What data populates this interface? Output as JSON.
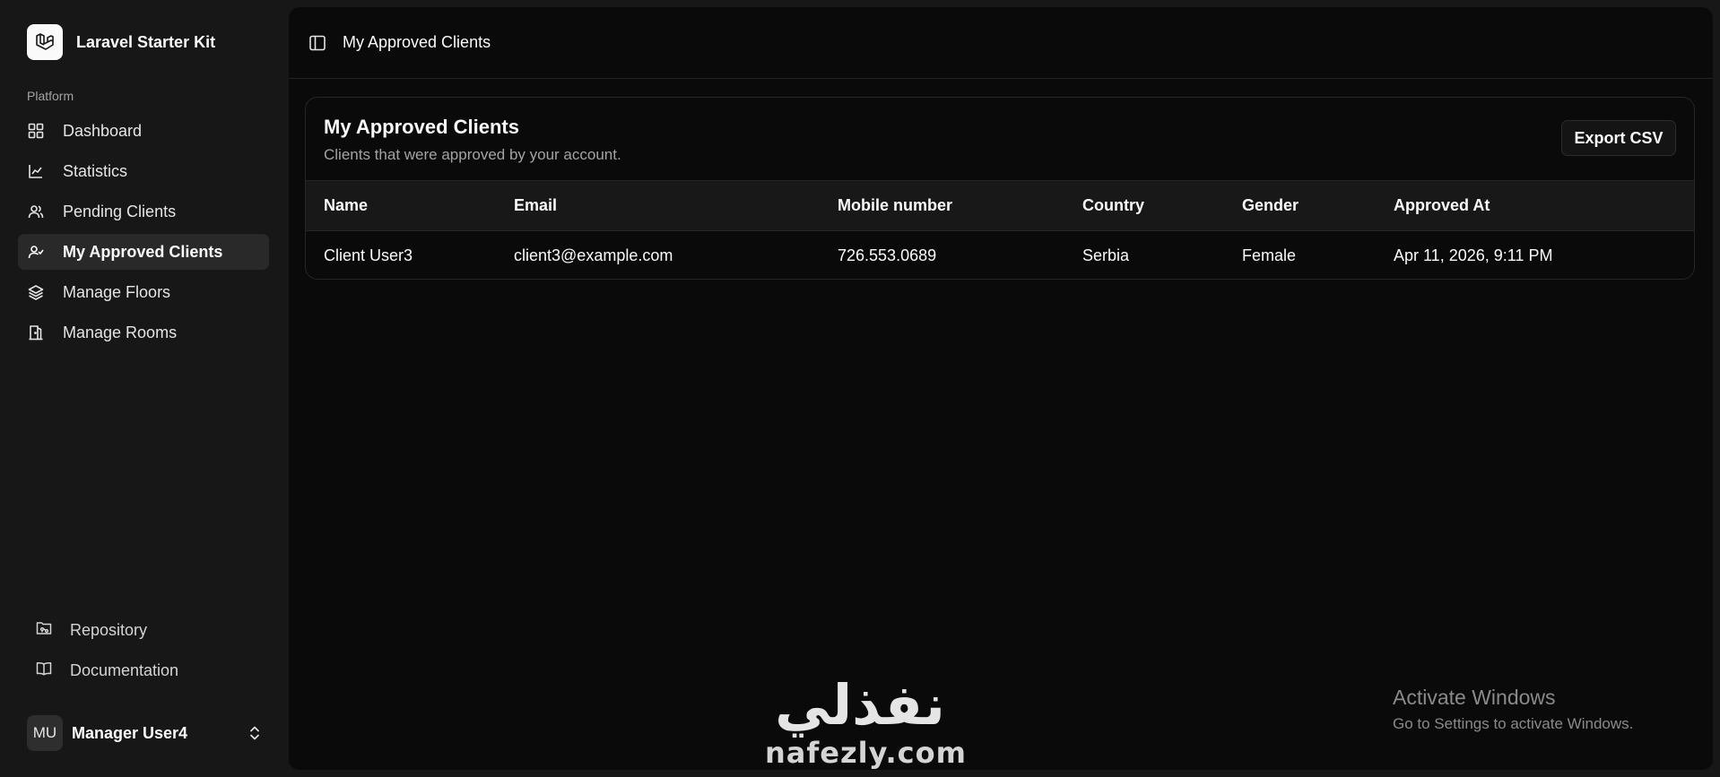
{
  "app": {
    "name": "Laravel Starter Kit"
  },
  "sidebar": {
    "section_label": "Platform",
    "items": [
      {
        "label": "Dashboard",
        "icon": "grid-icon"
      },
      {
        "label": "Statistics",
        "icon": "chart-icon"
      },
      {
        "label": "Pending Clients",
        "icon": "users-icon"
      },
      {
        "label": "My Approved Clients",
        "icon": "user-check-icon",
        "active": true
      },
      {
        "label": "Manage Floors",
        "icon": "layers-icon"
      },
      {
        "label": "Manage Rooms",
        "icon": "door-icon"
      }
    ],
    "footer": [
      {
        "label": "Repository",
        "icon": "folder-git-icon"
      },
      {
        "label": "Documentation",
        "icon": "book-icon"
      }
    ],
    "user": {
      "initials": "MU",
      "name": "Manager User4"
    }
  },
  "header": {
    "breadcrumb": "My Approved Clients"
  },
  "card": {
    "title": "My Approved Clients",
    "subtitle": "Clients that were approved by your account.",
    "export_label": "Export CSV"
  },
  "table": {
    "headers": [
      "Name",
      "Email",
      "Mobile number",
      "Country",
      "Gender",
      "Approved At"
    ],
    "rows": [
      [
        "Client User3",
        "client3@example.com",
        "726.553.0689",
        "Serbia",
        "Female",
        "Apr 11, 2026, 9:11 PM"
      ]
    ]
  },
  "watermark": {
    "arabic": "نفذلي",
    "latin": "nafezly.com"
  },
  "os_notice": {
    "title": "Activate Windows",
    "subtitle": "Go to Settings to activate Windows."
  }
}
